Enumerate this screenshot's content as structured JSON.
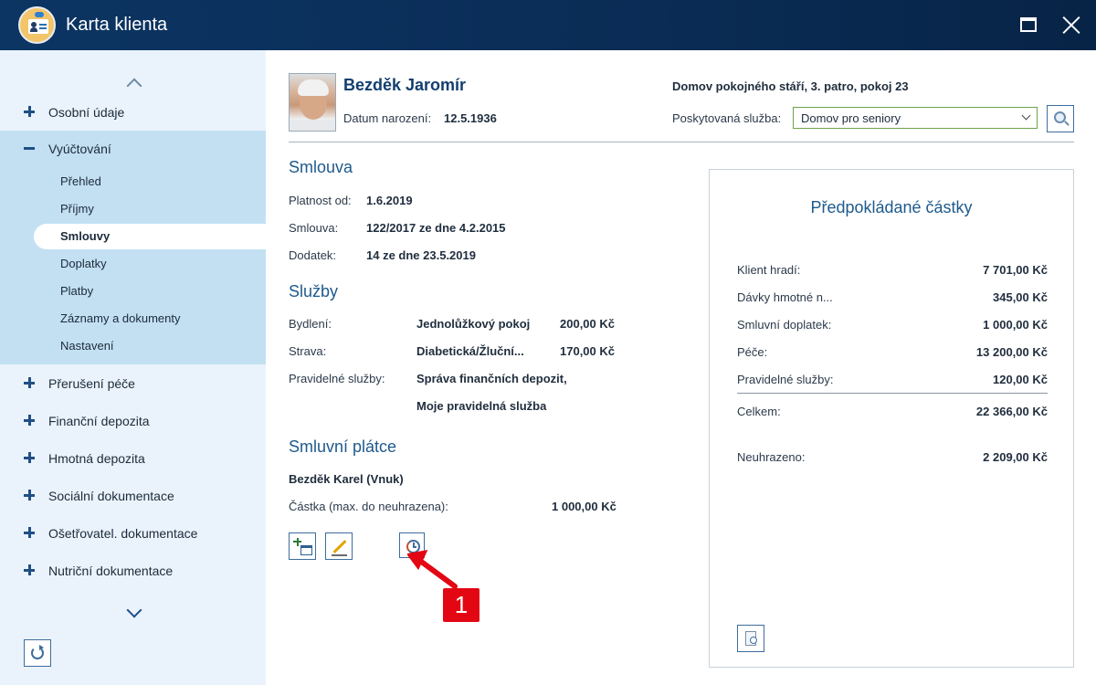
{
  "window": {
    "title": "Karta klienta"
  },
  "sidebar": {
    "items_top": [
      {
        "label": "Osobní údaje"
      },
      {
        "label": "Vyúčtování"
      }
    ],
    "sub_items": [
      {
        "label": "Přehled"
      },
      {
        "label": "Příjmy"
      },
      {
        "label": "Smlouvy"
      },
      {
        "label": "Doplatky"
      },
      {
        "label": "Platby"
      },
      {
        "label": "Záznamy a dokumenty"
      },
      {
        "label": "Nastavení"
      }
    ],
    "items_bottom": [
      {
        "label": "Přerušení péče"
      },
      {
        "label": "Finanční depozita"
      },
      {
        "label": "Hmotná depozita"
      },
      {
        "label": "Sociální dokumentace"
      },
      {
        "label": "Ošetřovatel. dokumentace"
      },
      {
        "label": "Nutriční dokumentace"
      }
    ]
  },
  "client": {
    "name": "Bezděk Jaromír",
    "birth_label": "Datum narození:",
    "birth_date": "12.5.1936",
    "location": "Domov pokojného stáří, 3. patro, pokoj 23",
    "service_label": "Poskytovaná služba:",
    "service_value": "Domov pro seniory"
  },
  "contract": {
    "title": "Smlouva",
    "valid_from_label": "Platnost od:",
    "valid_from": "1.6.2019",
    "contract_label": "Smlouva:",
    "contract_value": "122/2017 ze dne 4.2.2015",
    "amendment_label": "Dodatek:",
    "amendment_value": "14 ze dne 23.5.2019"
  },
  "services": {
    "title": "Služby",
    "housing_label": "Bydlení:",
    "housing_value": "Jednolůžkový pokoj",
    "housing_price": "200,00 Kč",
    "food_label": "Strava:",
    "food_value": "Diabetická/Žluční...",
    "food_price": "170,00 Kč",
    "regular_label": "Pravidelné služby:",
    "regular_value_1": "Správa finančních depozit,",
    "regular_value_2": "Moje pravidelná služba"
  },
  "payer": {
    "title": "Smluvní plátce",
    "name": "Bezděk Karel (Vnuk)",
    "amount_label": "Částka (max. do neuhrazena):",
    "amount_value": "1 000,00 Kč"
  },
  "callout": {
    "number": "1"
  },
  "summary": {
    "title": "Předpokládané částky",
    "rows": [
      {
        "label": "Klient hradí:",
        "value": "7 701,00 Kč"
      },
      {
        "label": "Dávky hmotné n...",
        "value": "345,00 Kč"
      },
      {
        "label": "Smluvní doplatek:",
        "value": "1 000,00 Kč"
      },
      {
        "label": "Péče:",
        "value": "13 200,00 Kč"
      },
      {
        "label": "Pravidelné služby:",
        "value": "120,00 Kč"
      }
    ],
    "total_label": "Celkem:",
    "total_value": "22 366,00 Kč",
    "unpaid_label": "Neuhrazeno:",
    "unpaid_value": "2 209,00 Kč"
  },
  "colors": {
    "titlebar": "#0c3563",
    "sidebar_bg": "#eaf3fb",
    "sidebar_expanded": "#c3e0f3",
    "accent": "#1e5a8c",
    "callout": "#e30613",
    "select_border": "#6da34c"
  }
}
